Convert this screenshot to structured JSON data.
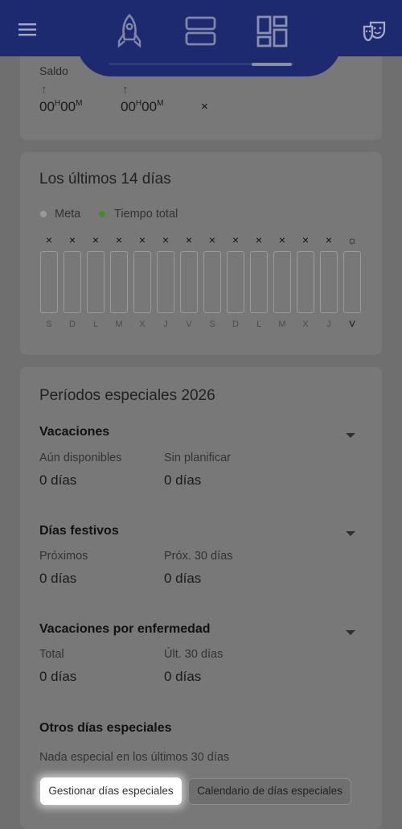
{
  "header": {
    "menu_icon": "menu-icon",
    "tabs": [
      {
        "icon": "rocket-icon"
      },
      {
        "icon": "rows-icon"
      },
      {
        "icon": "dashboard-icon",
        "active": true
      }
    ],
    "theater_icon": "theater-masks-icon",
    "color": "#1d2a70"
  },
  "balance": {
    "label": "Saldo",
    "items": [
      {
        "arrow": "↑",
        "hours": "00",
        "h": "H",
        "minutes": "00",
        "m": "M"
      },
      {
        "arrow": "↑",
        "hours": "00",
        "h": "H",
        "minutes": "00",
        "m": "M"
      }
    ],
    "close": "×"
  },
  "last14": {
    "title": "Los últimos 14 días",
    "legend": [
      {
        "label": "Meta",
        "color": "#9a9a9a"
      },
      {
        "label": "Tiempo total",
        "color": "#4a8a2a"
      }
    ],
    "marks": [
      "×",
      "×",
      "×",
      "×",
      "×",
      "×",
      "×",
      "×",
      "×",
      "×",
      "×",
      "×",
      "×",
      "☼"
    ],
    "days": [
      "S",
      "D",
      "L",
      "M",
      "X",
      "J",
      "V",
      "S",
      "D",
      "L",
      "M",
      "X",
      "J",
      "V"
    ]
  },
  "special": {
    "title": "Períodos especiales 2026",
    "vacaciones": {
      "title": "Vacaciones",
      "col1_label": "Aún disponibles",
      "col1_value": "0 días",
      "col2_label": "Sin planificar",
      "col2_value": "0 días"
    },
    "festivos": {
      "title": "Días festivos",
      "col1_label": "Próximos",
      "col1_value": "0 días",
      "col2_label": "Próx. 30 días",
      "col2_value": "0 días"
    },
    "enfermedad": {
      "title": "Vacaciones por enfermedad",
      "col1_label": "Total",
      "col1_value": "0 días",
      "col2_label": "Últ. 30 días",
      "col2_value": "0 días"
    },
    "otros": {
      "title": "Otros días especiales",
      "text": "Nada especial en los últimos 30 días"
    },
    "buttons": {
      "manage": "Gestionar días especiales",
      "calendar": "Calendario de días especiales"
    }
  }
}
